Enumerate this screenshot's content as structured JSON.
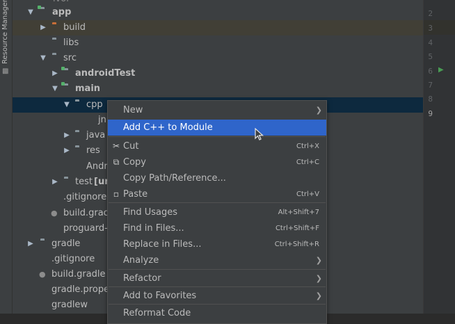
{
  "sidebar": {
    "label": "Resource Manager",
    "icon": "resource-manager-icon"
  },
  "tree": {
    "top_partial": "lvol",
    "app": "app",
    "build": "build",
    "libs": "libs",
    "src": "src",
    "androidTest": "androidTest",
    "main": "main",
    "cpp": "cpp",
    "cpp_child_partial": "jn",
    "java": "java",
    "res": "res",
    "manifest_partial": "Andr",
    "test_label": "test",
    "test_suffix": "[un",
    "gitignore_app": ".gitignore",
    "build_gradle_app_partial": "build.grac",
    "proguard_partial": "proguard-",
    "gradle": "gradle",
    "gitignore_root": ".gitignore",
    "build_gradle_root": "build.gradle",
    "gradle_properties_partial": "gradle.prope",
    "gradlew": "gradlew"
  },
  "gutter": {
    "lines": [
      "2",
      "3",
      "4",
      "5",
      "6",
      "7",
      "8",
      "9"
    ]
  },
  "context_menu": {
    "new": "New",
    "add_cpp": "Add C++ to Module",
    "cut": "Cut",
    "cut_sc": "Ctrl+X",
    "copy": "Copy",
    "copy_sc": "Ctrl+C",
    "copy_path": "Copy Path/Reference...",
    "paste": "Paste",
    "paste_sc": "Ctrl+V",
    "find_usages": "Find Usages",
    "find_usages_sc": "Alt+Shift+7",
    "find_in_files": "Find in Files...",
    "find_in_files_sc": "Ctrl+Shift+F",
    "replace_in_files": "Replace in Files...",
    "replace_in_files_sc": "Ctrl+Shift+R",
    "analyze": "Analyze",
    "refactor": "Refactor",
    "add_to_favorites": "Add to Favorites",
    "reformat_partial": "Reformat Code"
  },
  "colors": {
    "selection": "#2f65ca",
    "tree_bg": "#3c3f41",
    "selected_row": "#0d293e"
  }
}
